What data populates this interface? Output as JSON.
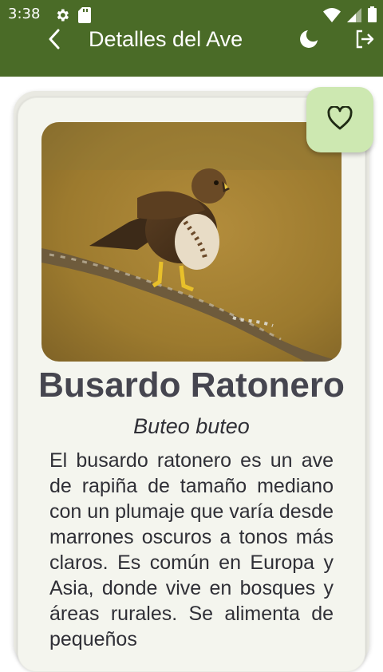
{
  "status_bar": {
    "time": "3:38",
    "left_icons": [
      "gear-icon",
      "sd-card-icon"
    ],
    "right_icons": [
      "wifi-icon",
      "signal-icon",
      "battery-icon"
    ]
  },
  "toolbar": {
    "title": "Detalles del Ave",
    "back_icon": "chevron-left-icon",
    "theme_icon": "moon-icon",
    "logout_icon": "logout-icon"
  },
  "bird": {
    "common_name": "Busardo Ratonero",
    "scientific_name": "Buteo buteo",
    "description": "El busardo ratonero es un ave de rapiña de tamaño mediano con un plumaje que varía desde marrones oscuros a tonos más claros. Es común en Europa y Asia, donde vive en bosques y áreas rurales. Se alimenta de pequeños"
  },
  "favorite": {
    "icon": "heart-outline-icon"
  },
  "colors": {
    "appbar": "#4a6b27",
    "card": "#f4f5ee",
    "favorite_button": "#cde8b1",
    "text_primary": "#45454f"
  }
}
